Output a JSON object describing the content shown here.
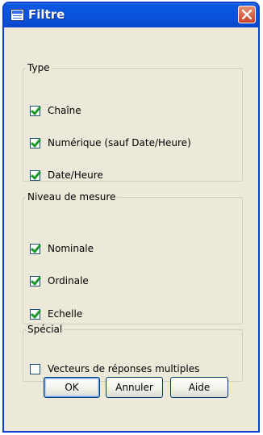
{
  "window": {
    "title": "Filtre"
  },
  "type_group": {
    "legend": "Type",
    "items": [
      {
        "label": "Chaîne",
        "checked": true
      },
      {
        "label": "Numérique (sauf Date/Heure)",
        "checked": true
      },
      {
        "label": "Date/Heure",
        "checked": true
      }
    ]
  },
  "niveau_group": {
    "legend": "Niveau de mesure",
    "items": [
      {
        "label": "Nominale",
        "checked": true
      },
      {
        "label": "Ordinale",
        "checked": true
      },
      {
        "label": "Echelle",
        "checked": true
      }
    ]
  },
  "special_group": {
    "legend": "Spécial",
    "items": [
      {
        "label": "Vecteurs de réponses multiples",
        "checked": false
      }
    ]
  },
  "buttons": {
    "ok": "OK",
    "annuler": "Annuler",
    "aide": "Aide"
  }
}
